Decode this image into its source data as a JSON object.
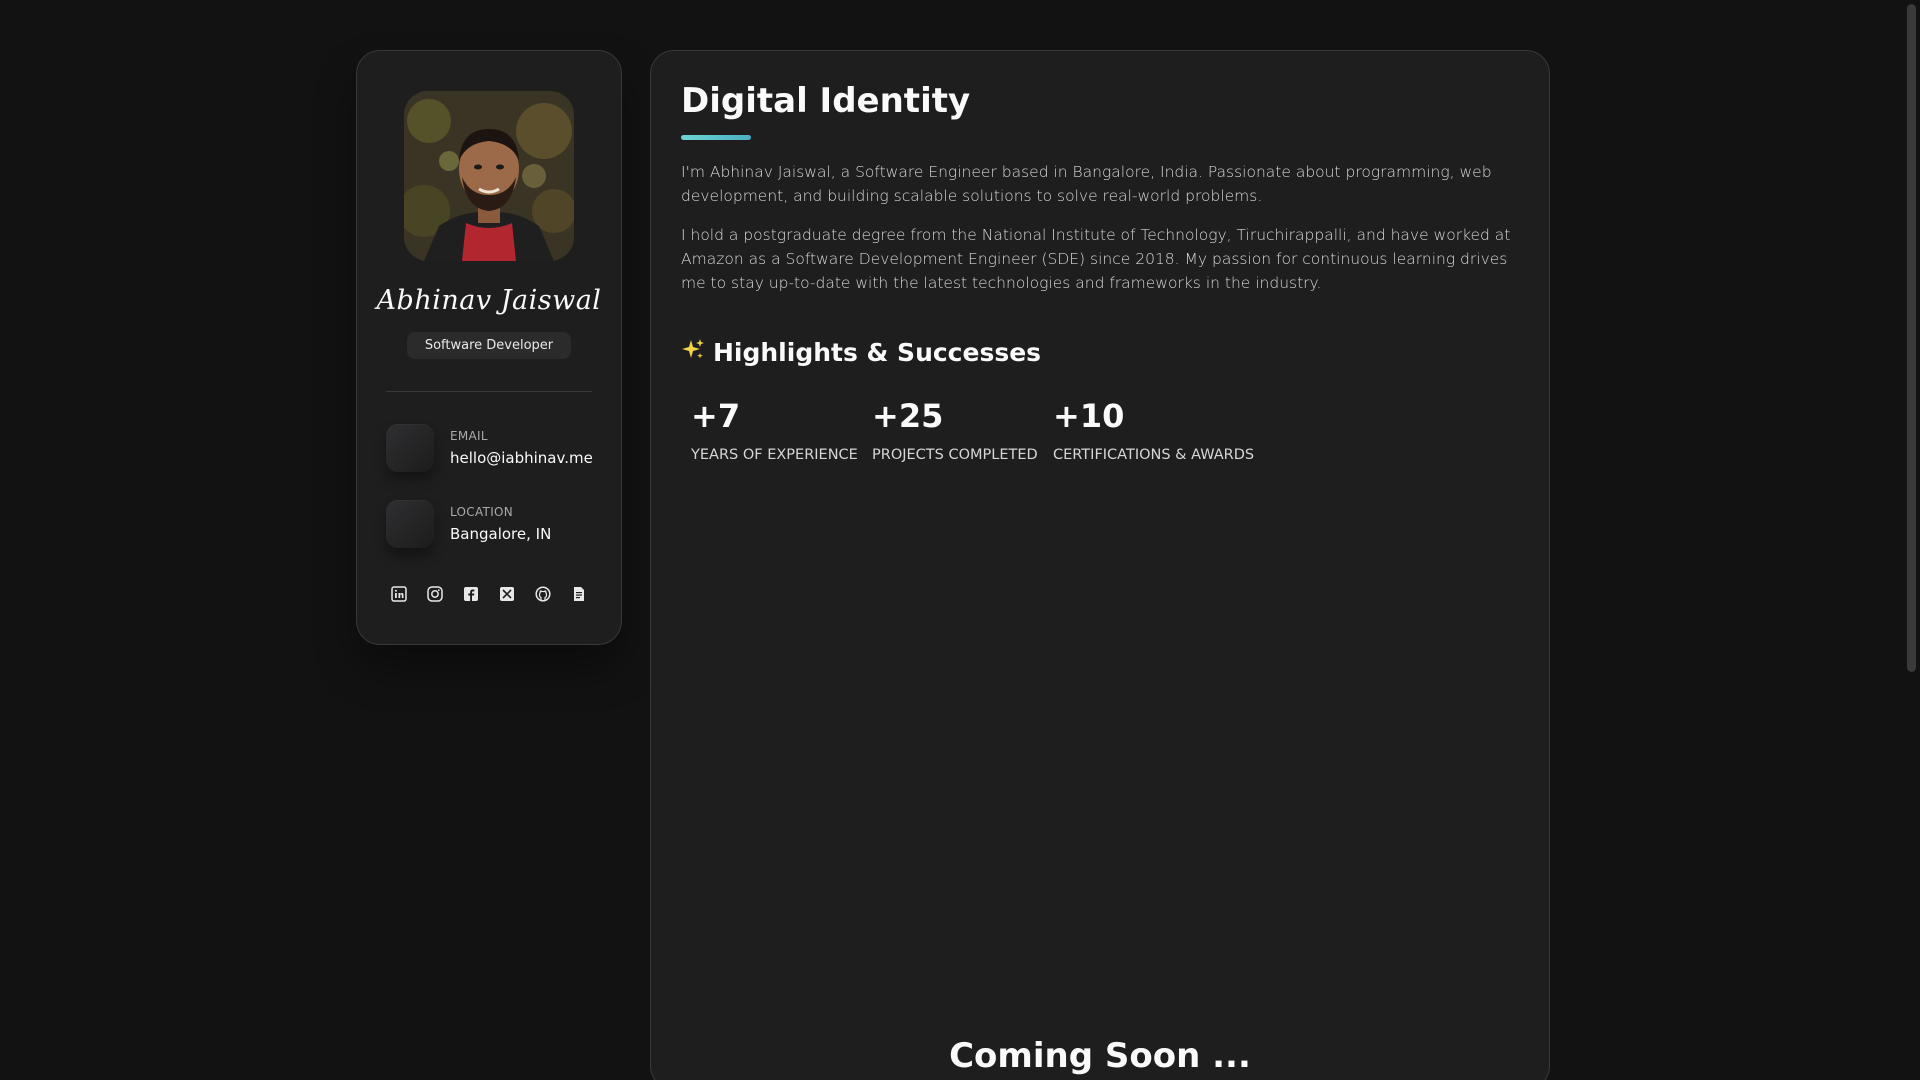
{
  "sidebar": {
    "name": "Abhinav Jaiswal",
    "role": "Software Developer",
    "contacts": [
      {
        "label": "EMAIL",
        "value": "hello@iabhinav.me",
        "icon": "mail-icon"
      },
      {
        "label": "LOCATION",
        "value": "Bangalore, IN",
        "icon": "location-icon"
      }
    ],
    "socials": [
      "linkedin-icon",
      "instagram-icon",
      "facebook-icon",
      "x-icon",
      "github-icon",
      "resume-icon"
    ]
  },
  "main": {
    "title": "Digital Identity",
    "about": [
      "I'm Abhinav Jaiswal, a Software Engineer based in Bangalore, India. Passionate about programming, web development, and building scalable solutions to solve real-world problems.",
      "I hold a postgraduate degree from the National Institute of Technology, Tiruchirappalli, and have worked at Amazon as a Software Development Engineer (SDE) since 2018. My passion for continuous learning drives me to stay up-to-date with the latest technologies and frameworks in the industry."
    ],
    "highlights_title": "Highlights & Successes",
    "highlights_icon": "sparkles-icon",
    "stats": [
      {
        "value": "+7",
        "label": "YEARS OF EXPERIENCE"
      },
      {
        "value": "+25",
        "label": "PROJECTS COMPLETED"
      },
      {
        "value": "+10",
        "label": "CERTIFICATIONS & AWARDS"
      }
    ],
    "coming_soon": "Coming Soon ..."
  },
  "colors": {
    "background": "#121212",
    "card": "#1e1e1f",
    "border": "#383838",
    "accent": "#6fd3d3",
    "text": "#fafafa",
    "muted": "#d6d6d6",
    "sparkle": "#f5d547"
  }
}
